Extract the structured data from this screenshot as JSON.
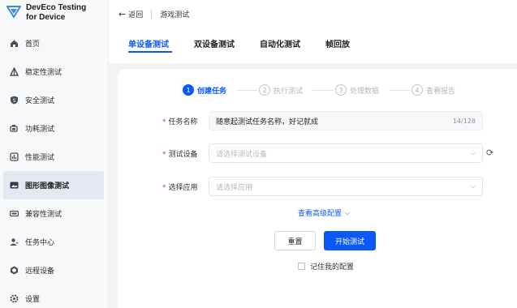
{
  "app": {
    "name_line1": "DevEco Testing",
    "name_line2": "for Device",
    "accent": "#0a59f7"
  },
  "sidebar": {
    "items": [
      {
        "label": "首页",
        "icon": "home-icon",
        "active": false
      },
      {
        "label": "稳定性测试",
        "icon": "stability-icon",
        "active": false
      },
      {
        "label": "安全测试",
        "icon": "security-icon",
        "active": false
      },
      {
        "label": "功耗测试",
        "icon": "power-icon",
        "active": false
      },
      {
        "label": "性能测试",
        "icon": "performance-icon",
        "active": false
      },
      {
        "label": "图形图像测试",
        "icon": "image-icon",
        "active": true
      },
      {
        "label": "兼容性测试",
        "icon": "compatibility-icon",
        "active": false
      },
      {
        "label": "任务中心",
        "icon": "task-center-icon",
        "active": false
      },
      {
        "label": "远程设备",
        "icon": "remote-device-icon",
        "active": false
      },
      {
        "label": "设置",
        "icon": "settings-icon",
        "active": false
      }
    ]
  },
  "header": {
    "back_label": "返回",
    "title": "游戏测试"
  },
  "tabs": [
    {
      "label": "单设备测试",
      "active": true
    },
    {
      "label": "双设备测试",
      "active": false
    },
    {
      "label": "自动化测试",
      "active": false
    },
    {
      "label": "帧回放",
      "active": false
    }
  ],
  "steps": [
    {
      "num": "1",
      "label": "创建任务",
      "active": true
    },
    {
      "num": "2",
      "label": "执行测试",
      "active": false
    },
    {
      "num": "3",
      "label": "处理数据",
      "active": false
    },
    {
      "num": "4",
      "label": "查看报告",
      "active": false
    }
  ],
  "form": {
    "task_name_label": "任务名称",
    "task_name_value": "随意起测试任务名称，好记就成",
    "task_name_counter": "14/128",
    "device_label": "测试设备",
    "device_placeholder": "请选择测试设备",
    "app_label": "选择应用",
    "app_placeholder": "请选择应用",
    "advanced_label": "查看高级配置",
    "reset_label": "重置",
    "start_label": "开始测试",
    "remember_label": "记住我的配置",
    "remember_checked": false
  }
}
